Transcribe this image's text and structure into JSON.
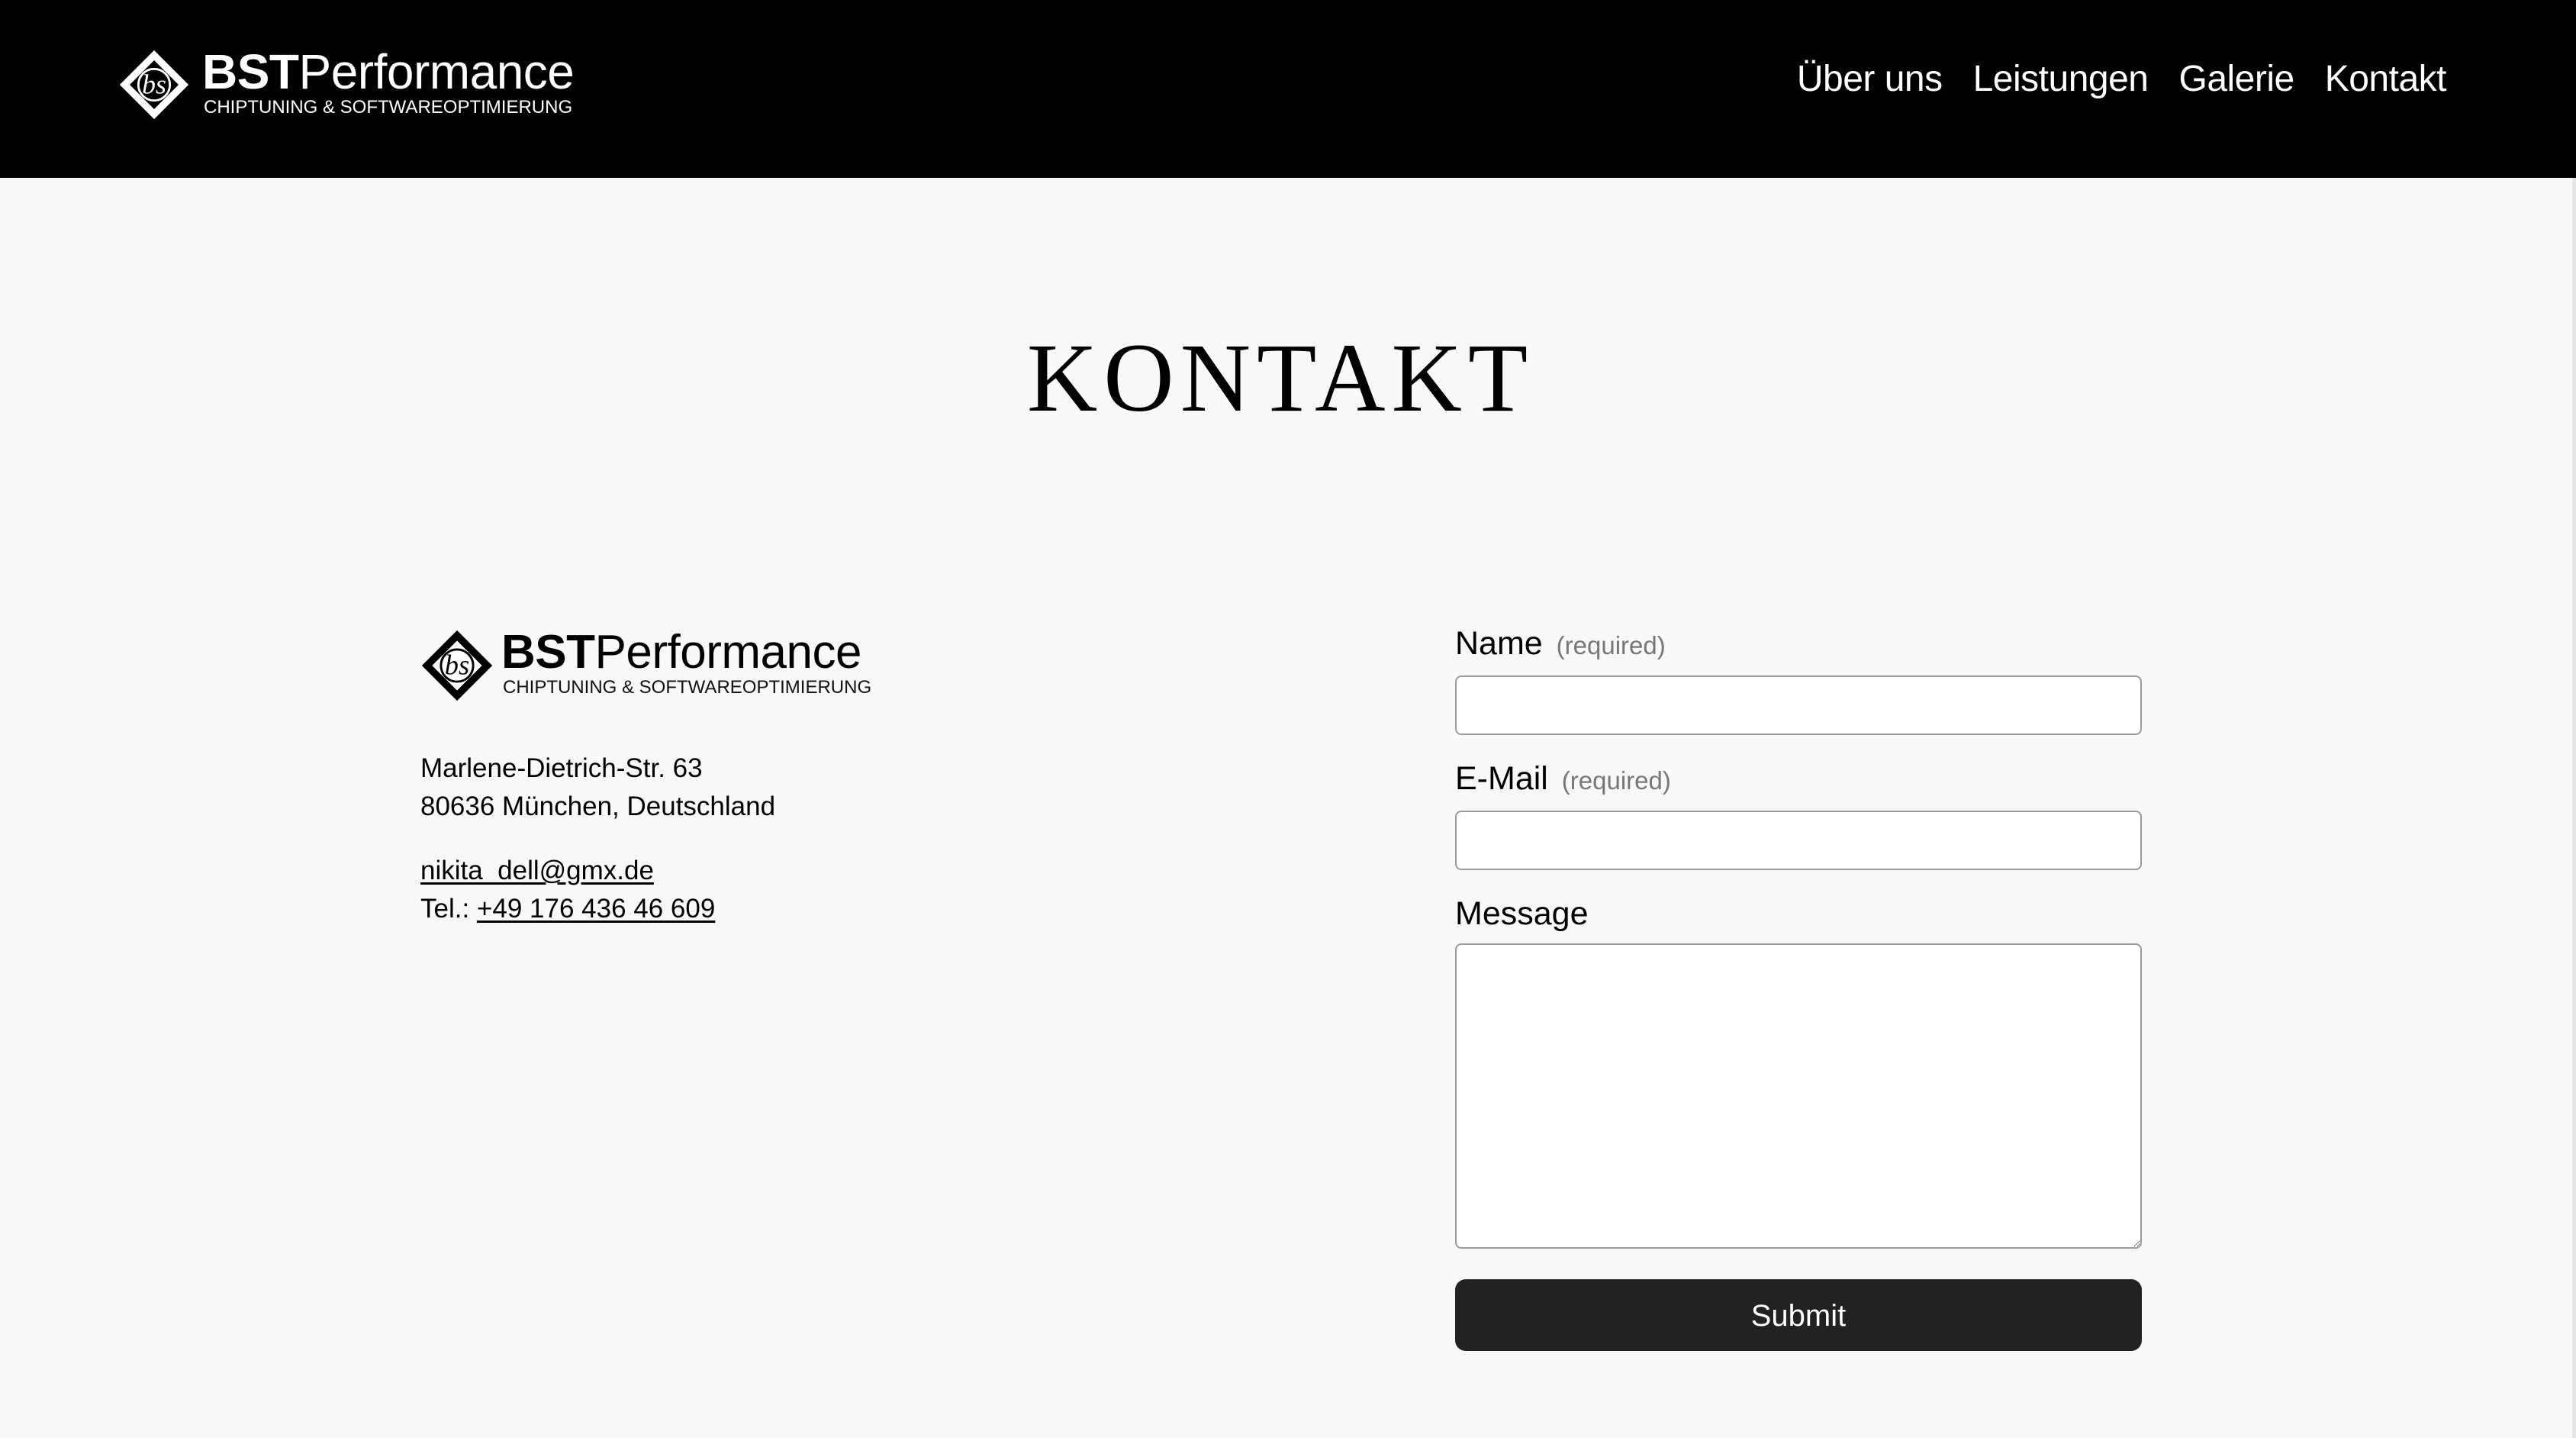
{
  "header": {
    "logo": {
      "brand_bold": "BST",
      "brand_light": "Performance",
      "tagline": "CHIPTUNING & SOFTWAREOPTIMIERUNG"
    },
    "nav": [
      {
        "label": "Über uns"
      },
      {
        "label": "Leistungen"
      },
      {
        "label": "Galerie"
      },
      {
        "label": "Kontakt"
      }
    ]
  },
  "main": {
    "title": "KONTAKT",
    "contact": {
      "logo": {
        "brand_bold": "BST",
        "brand_light": "Performance",
        "tagline": "CHIPTUNING & SOFTWAREOPTIMIERUNG"
      },
      "street": "Marlene-Dietrich-Str. 63",
      "city": "80636 München, Deutschland",
      "email": "nikita_dell@gmx.de",
      "phone_prefix": "Tel.: ",
      "phone": "+49 176 436 46 609"
    },
    "form": {
      "name_label": "Name",
      "name_required": "(required)",
      "name_value": "",
      "email_label": "E-Mail",
      "email_required": "(required)",
      "email_value": "",
      "message_label": "Message",
      "message_value": "",
      "submit_label": "Submit"
    }
  },
  "colors": {
    "header_bg": "#000000",
    "page_bg": "#f8f8f8",
    "button_bg": "#222222",
    "required_text": "#777777"
  },
  "icons": {
    "logo_mark": "bst-diamond-logo-icon"
  }
}
